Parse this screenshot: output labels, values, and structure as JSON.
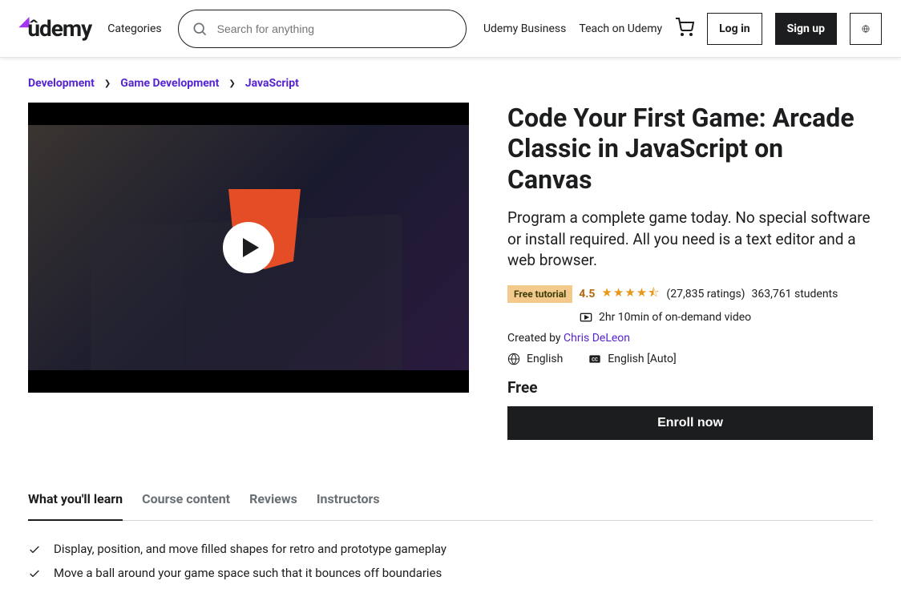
{
  "header": {
    "logo": "ûdemy",
    "categories": "Categories",
    "search_placeholder": "Search for anything",
    "business": "Udemy Business",
    "teach": "Teach on Udemy",
    "login": "Log in",
    "signup": "Sign up"
  },
  "breadcrumbs": [
    "Development",
    "Game Development",
    "JavaScript"
  ],
  "course": {
    "title": "Code Your First Game: Arcade Classic in JavaScript on Canvas",
    "subtitle": "Program a complete game today. No special software or install required. All you need is a text editor and a web browser.",
    "badge": "Free tutorial",
    "rating": "4.5",
    "ratings_count": "(27,835 ratings)",
    "students": "363,761 students",
    "duration": "2hr 10min of on-demand video",
    "created_by_label": "Created by ",
    "author": "Chris DeLeon",
    "language": "English",
    "captions": "English [Auto]",
    "price": "Free",
    "enroll": "Enroll now"
  },
  "tabs": [
    "What you'll learn",
    "Course content",
    "Reviews",
    "Instructors"
  ],
  "learn_items": [
    "Display, position, and move filled shapes for retro and prototype gameplay",
    "Move a ball around your game space such that it bounces off boundaries"
  ]
}
